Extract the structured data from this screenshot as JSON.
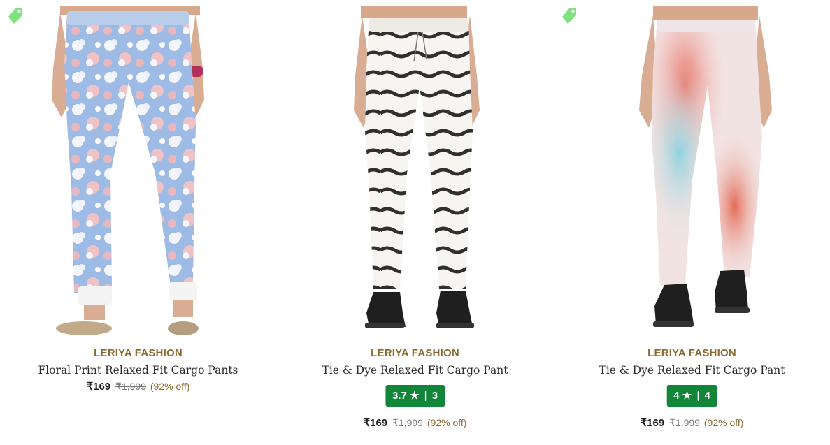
{
  "products": [
    {
      "brand": "LERIYA FASHION",
      "title": "Floral Print Relaxed Fit Cargo Pants",
      "price": "₹169",
      "mrp": "₹1,999",
      "discount": "(92% off)",
      "rating": null,
      "tag_icon": true,
      "image": "floral-blue-cargo-pants"
    },
    {
      "brand": "LERIYA FASHION",
      "title": "Tie & Dye Relaxed Fit Cargo Pant",
      "price": "₹169",
      "mrp": "₹1,999",
      "discount": "(92% off)",
      "rating": {
        "score": "3.7",
        "star": "★",
        "count": "3"
      },
      "tag_icon": false,
      "image": "black-white-stripe-cargo-pants"
    },
    {
      "brand": "LERIYA FASHION",
      "title": "Tie & Dye Relaxed Fit Cargo Pant",
      "price": "₹169",
      "mrp": "₹1,999",
      "discount": "(92% off)",
      "rating": {
        "score": "4",
        "star": "★",
        "count": "4"
      },
      "tag_icon": true,
      "image": "pink-teal-tie-dye-cargo-pants"
    }
  ],
  "colors": {
    "brand": "#8a6a2e",
    "rating_bg": "#118538",
    "tag_icon": "#7ee27e"
  },
  "icons": {
    "tag": "price-tag-icon",
    "star": "star-icon"
  }
}
